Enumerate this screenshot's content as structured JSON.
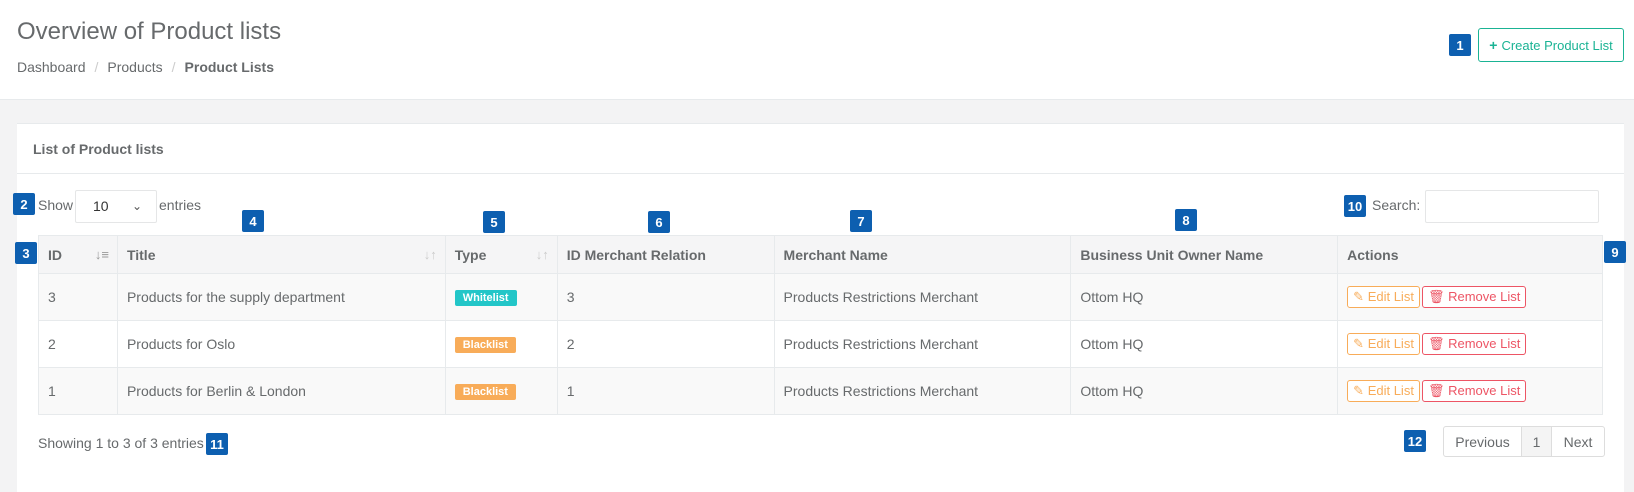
{
  "header": {
    "title": "Overview of Product lists",
    "breadcrumb": [
      "Dashboard",
      "Products",
      "Product Lists"
    ],
    "breadcrumb_sep": "/",
    "create_button": "Create Product List"
  },
  "panel": {
    "title": "List of Product lists",
    "show_label": "Show",
    "entries_label": "entries",
    "page_length": "10",
    "search_label": "Search:",
    "search_value": ""
  },
  "table": {
    "columns": [
      "ID",
      "Title",
      "Type",
      "ID Merchant Relation",
      "Merchant Name",
      "Business Unit Owner Name",
      "Actions"
    ],
    "rows": [
      {
        "id": "3",
        "title": "Products for the supply department",
        "type": "Whitelist",
        "merchant_relation": "3",
        "merchant_name": "Products Restrictions Merchant",
        "owner": "Ottom HQ"
      },
      {
        "id": "2",
        "title": "Products for Oslo",
        "type": "Blacklist",
        "merchant_relation": "2",
        "merchant_name": "Products Restrictions Merchant",
        "owner": "Ottom HQ"
      },
      {
        "id": "1",
        "title": "Products for Berlin & London",
        "type": "Blacklist",
        "merchant_relation": "1",
        "merchant_name": "Products Restrictions Merchant",
        "owner": "Ottom HQ"
      }
    ],
    "edit_label": "Edit List",
    "remove_label": "Remove List"
  },
  "footer": {
    "showing": "Showing 1 to 3 of 3 entries",
    "prev": "Previous",
    "page": "1",
    "next": "Next"
  },
  "annotations": [
    "1",
    "2",
    "3",
    "4",
    "5",
    "6",
    "7",
    "8",
    "9",
    "10",
    "11",
    "12"
  ],
  "colors": {
    "primary": "#1ab394",
    "whitelist": "#23c6c8",
    "blacklist": "#f8ac59",
    "danger": "#ed5565",
    "marker": "#0d5fb0"
  }
}
